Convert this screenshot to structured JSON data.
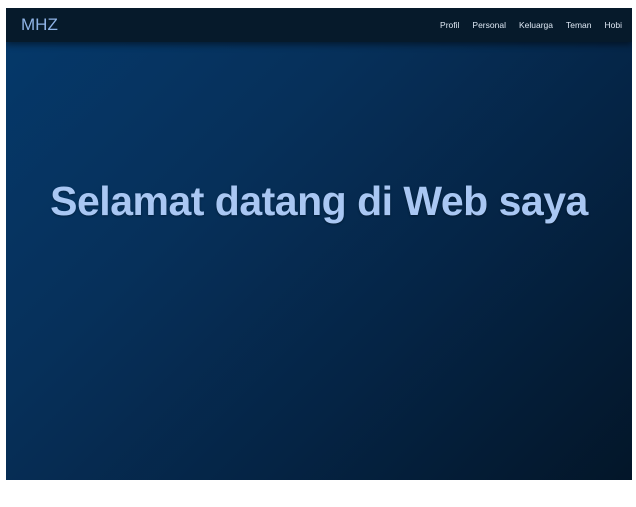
{
  "navbar": {
    "brand": "MHZ",
    "links": [
      {
        "label": "Profil"
      },
      {
        "label": "Personal"
      },
      {
        "label": "Keluarga"
      },
      {
        "label": "Teman"
      },
      {
        "label": "Hobi"
      }
    ]
  },
  "hero": {
    "title": "Selamat datang di Web saya"
  },
  "colors": {
    "navbar_bg": "#061a2b",
    "hero_bg_start": "#05396b",
    "hero_bg_end": "#031629",
    "brand_text": "#8fb3e6",
    "hero_text": "#a9c7f3",
    "nav_text": "#dfe9f5"
  }
}
